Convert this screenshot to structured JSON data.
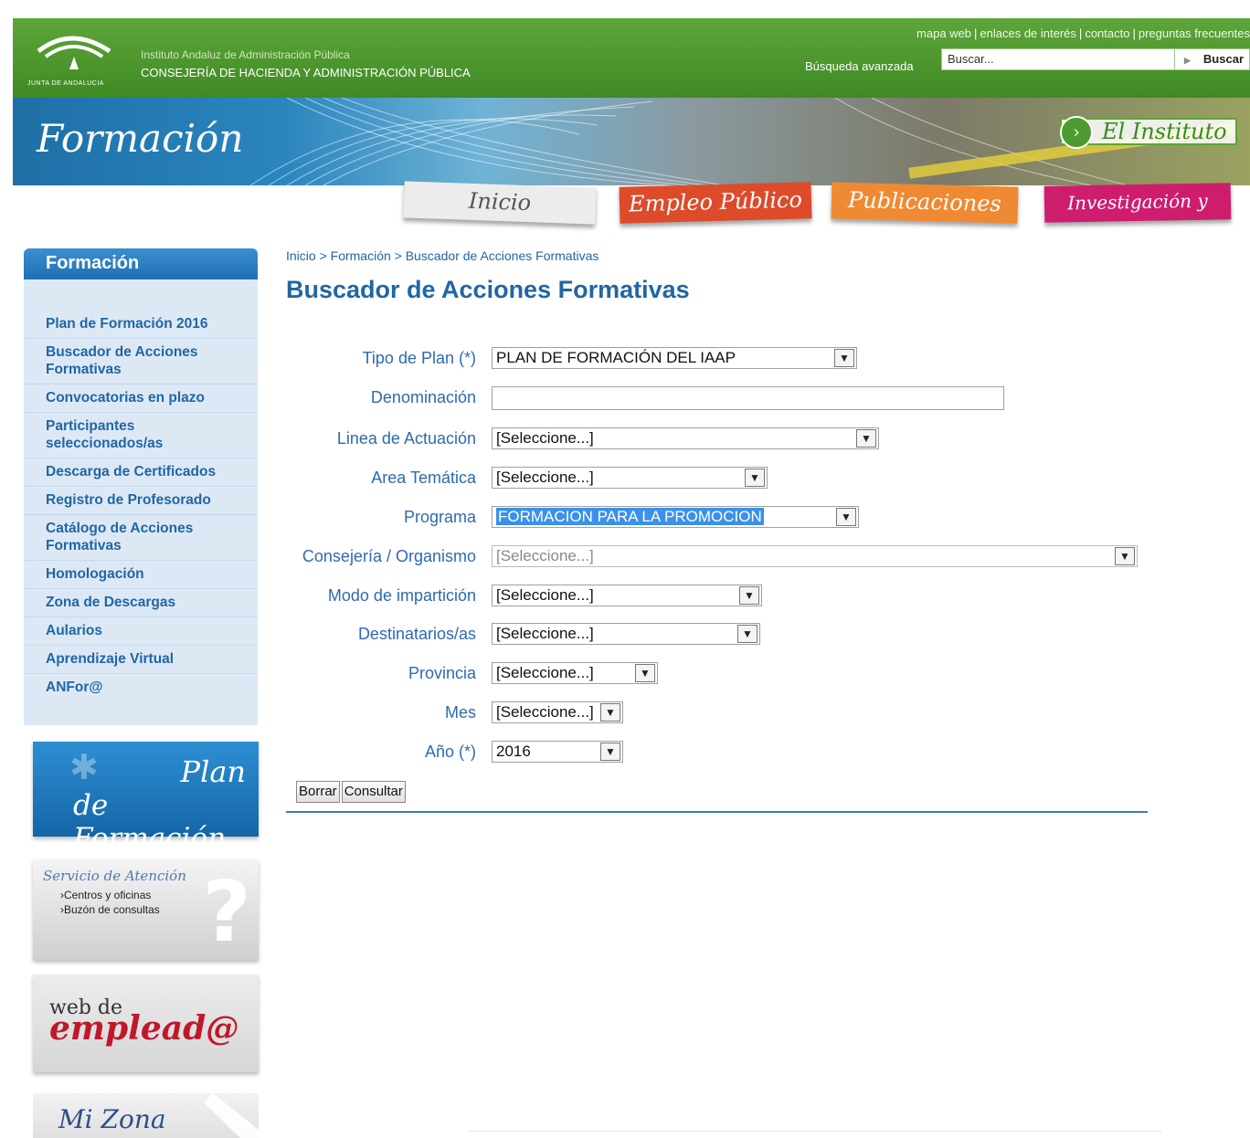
{
  "header": {
    "logo_caption": "JUNTA DE ANDALUCIA",
    "institute": "Instituto Andaluz de Administración Pública",
    "consejeria": "CONSEJERÍA DE HACIENDA Y ADMINISTRACIÓN PÚBLICA",
    "top_links": [
      "mapa web",
      "enlaces de interés",
      "contacto",
      "preguntas frecuentes"
    ],
    "advanced_search": "Búsqueda avanzada",
    "search_value": "Buscar...",
    "search_button": "Buscar",
    "banner_title": "Formación",
    "institute_button": "El Instituto",
    "colors": {
      "green": "#4c9b2e",
      "blue": "#2166a4"
    }
  },
  "nav_tabs": {
    "inicio": "Inicio",
    "empleo": "Empleo Público",
    "publicaciones": "Publicaciones",
    "investigacion": "Investigación y estudios"
  },
  "sidebar": {
    "title": "Formación",
    "items": [
      "Plan de Formación 2016",
      "Buscador de Acciones Formativas",
      "Convocatorias en plazo",
      "Participantes seleccionados/as",
      "Descarga de Certificados",
      "Registro de Profesorado",
      "Catálogo de Acciones Formativas",
      "Homologación",
      "Zona de Descargas",
      "Aularios",
      "Aprendizaje Virtual",
      "ANFor@"
    ]
  },
  "promos": {
    "plan_line1": "Plan",
    "plan_line2": "de Formación",
    "atencion_title": "Servicio de Atención",
    "atencion_link1": "Centros y oficinas",
    "atencion_link2": "Buzón de consultas",
    "empleado_line1": "web de",
    "empleado_line2": "emplead@",
    "mizona": "Mi Zona"
  },
  "main": {
    "breadcrumb": "Inicio > Formación > Buscador de Acciones Formativas",
    "title": "Buscador de Acciones Formativas"
  },
  "form": {
    "tipo_plan": {
      "label": "Tipo de Plan (*)",
      "value": "PLAN DE FORMACIÓN DEL IAAP"
    },
    "denominacion": {
      "label": "Denominación",
      "value": ""
    },
    "linea": {
      "label": "Linea de Actuación",
      "value": "[Seleccione...]"
    },
    "area": {
      "label": "Area Temática",
      "value": "[Seleccione...]"
    },
    "programa": {
      "label": "Programa",
      "value": "FORMACION PARA LA PROMOCION"
    },
    "consejeria": {
      "label": "Consejería / Organismo",
      "value": "[Seleccione...]"
    },
    "modo": {
      "label": "Modo de impartición",
      "value": "[Seleccione...]"
    },
    "destinatarios": {
      "label": "Destinatarios/as",
      "value": "[Seleccione...]"
    },
    "provincia": {
      "label": "Provincia",
      "value": "[Seleccione...]"
    },
    "mes": {
      "label": "Mes",
      "value": "[Seleccione...]"
    },
    "anio": {
      "label": "Año (*)",
      "value": "2016"
    },
    "borrar": "Borrar",
    "consultar": "Consultar"
  }
}
